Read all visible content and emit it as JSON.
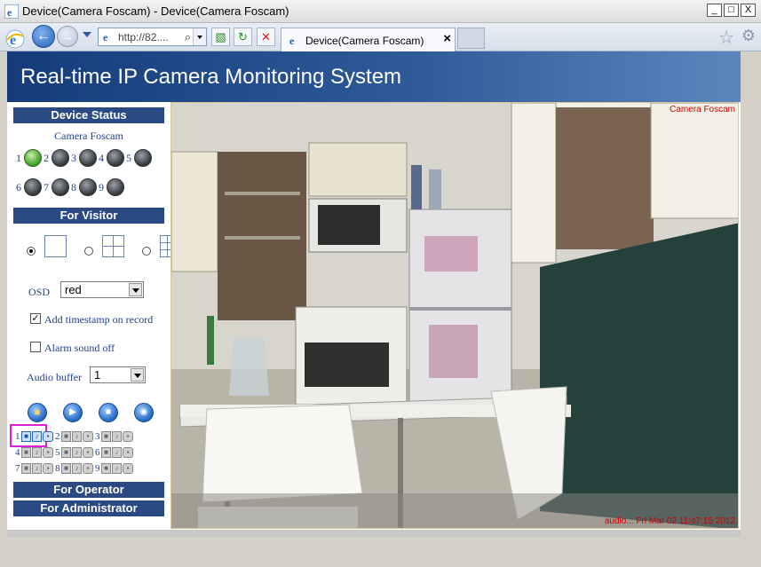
{
  "window": {
    "title": "Device(Camera Foscam) - Device(Camera Foscam)",
    "minimize": "_",
    "maximize": "□",
    "close": "X"
  },
  "browser": {
    "address": "http://82....",
    "search_glyph": "⌕",
    "tab_label": "Device(Camera Foscam)",
    "tab_close": "×",
    "compat_glyph": "▧",
    "refresh_glyph": "↻",
    "stop_glyph": "✕",
    "star_glyph": "☆",
    "gear_glyph": "⚙"
  },
  "header": {
    "title": "Real-time IP Camera Monitoring System"
  },
  "sidebar": {
    "device_status": "Device Status",
    "camera_name": "Camera Foscam",
    "leds": [
      {
        "num": "1",
        "on": true
      },
      {
        "num": "2",
        "on": false
      },
      {
        "num": "3",
        "on": false
      },
      {
        "num": "4",
        "on": false
      },
      {
        "num": "5",
        "on": false
      },
      {
        "num": "6",
        "on": false
      },
      {
        "num": "7",
        "on": false
      },
      {
        "num": "8",
        "on": false
      },
      {
        "num": "9",
        "on": false
      }
    ],
    "for_visitor": "For Visitor",
    "osd_label": "OSD",
    "osd_value": "red",
    "timestamp_label": "Add timestamp on record",
    "timestamp_checked": "✓",
    "alarm_label": "Alarm sound off",
    "audio_buffer_label": "Audio buffer",
    "audio_buffer_value": "1",
    "channels": [
      "1",
      "2",
      "3",
      "4",
      "5",
      "6",
      "7",
      "8",
      "9"
    ],
    "for_operator": "For Operator",
    "for_administrator": "For Administrator"
  },
  "video": {
    "osd_name": "Camera Foscam",
    "osd_timestamp": "audio...  Fri Mar 02 11:47:15 2012"
  },
  "colors": {
    "header_dark": "#153b7a",
    "section_bar": "#2b4a83",
    "osd_text": "#d00000"
  }
}
